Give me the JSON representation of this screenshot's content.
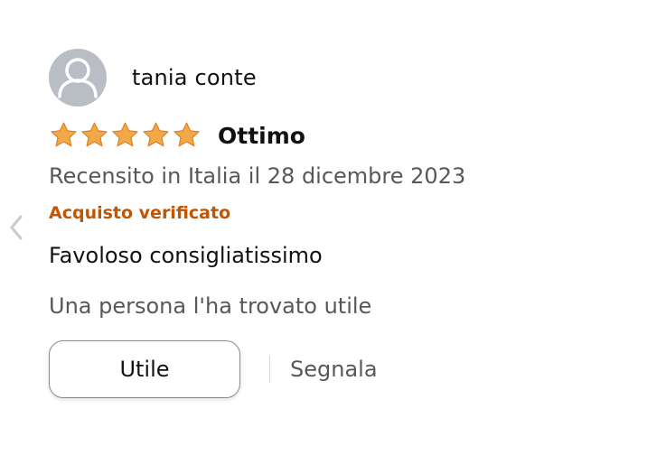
{
  "review": {
    "reviewer_name": "tania conte",
    "rating": 5,
    "rating_max": 5,
    "title": "Ottimo",
    "date_text": "Recensito in Italia il 28 dicembre 2023",
    "verified_label": "Acquisto verificato",
    "body": "Favoloso consigliatissimo",
    "helpful_count_text": "Una persona l'ha trovato utile",
    "helpful_button_label": "Utile",
    "report_label": "Segnala"
  },
  "icons": {
    "avatar": "user-silhouette-icon",
    "star": "star-icon",
    "nav_prev": "chevron-left-icon"
  },
  "colors": {
    "star_fill": "#f3a847",
    "verified": "#c45500",
    "secondary_text": "#565959",
    "avatar_bg": "#b8bec4"
  }
}
